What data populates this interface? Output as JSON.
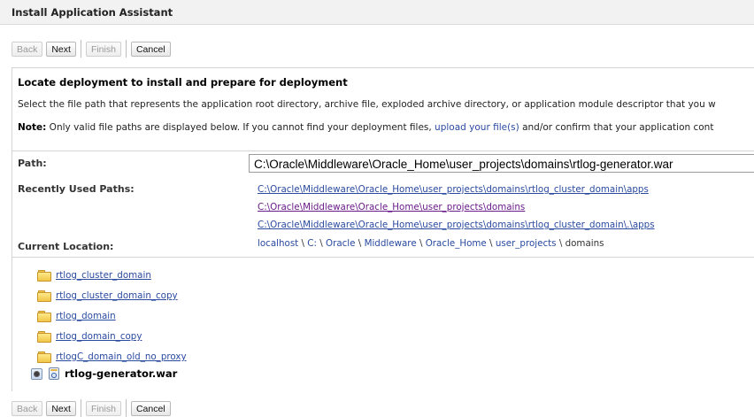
{
  "window": {
    "title": "Install Application Assistant"
  },
  "toolbar": {
    "back": "Back",
    "next": "Next",
    "finish": "Finish",
    "cancel": "Cancel"
  },
  "content": {
    "heading": "Locate deployment to install and prepare for deployment",
    "description": "Select the file path that represents the application root directory, archive file, exploded archive directory, or application module descriptor that you w",
    "note": {
      "label": "Note:",
      "text_before": " Only valid file paths are displayed below. If you cannot find your deployment files, ",
      "link": "upload your file(s)",
      "text_after": " and/or confirm that your application cont"
    }
  },
  "form": {
    "path_label": "Path:",
    "path_value": "C:\\Oracle\\Middleware\\Oracle_Home\\user_projects\\domains\\rtlog-generator.war",
    "recent_label": "Recently Used Paths:",
    "recent_paths": [
      "C:\\Oracle\\Middleware\\Oracle_Home\\user_projects\\domains\\rtlog_cluster_domain\\apps",
      "C:\\Oracle\\Middleware\\Oracle_Home\\user_projects\\domains",
      "C:\\Oracle\\Middleware\\Oracle_Home\\user_projects\\domains\\rtlog_cluster_domain\\.\\apps"
    ],
    "location_label": "Current Location:",
    "location_crumbs": [
      "localhost",
      "C:",
      "Oracle",
      "Middleware",
      "Oracle_Home",
      "user_projects",
      "domains"
    ],
    "crumb_separator": "\\"
  },
  "file_list": {
    "folders": [
      "rtlog_cluster_domain",
      "rtlog_cluster_domain_copy",
      "rtlog_domain",
      "rtlog_domain_copy",
      "rtlogC_domain_old_no_proxy"
    ],
    "selected_file": "rtlog-generator.war"
  },
  "icons": {
    "folder": "folder-icon",
    "war_file": "war-file-icon",
    "radio": "radio-selected"
  }
}
